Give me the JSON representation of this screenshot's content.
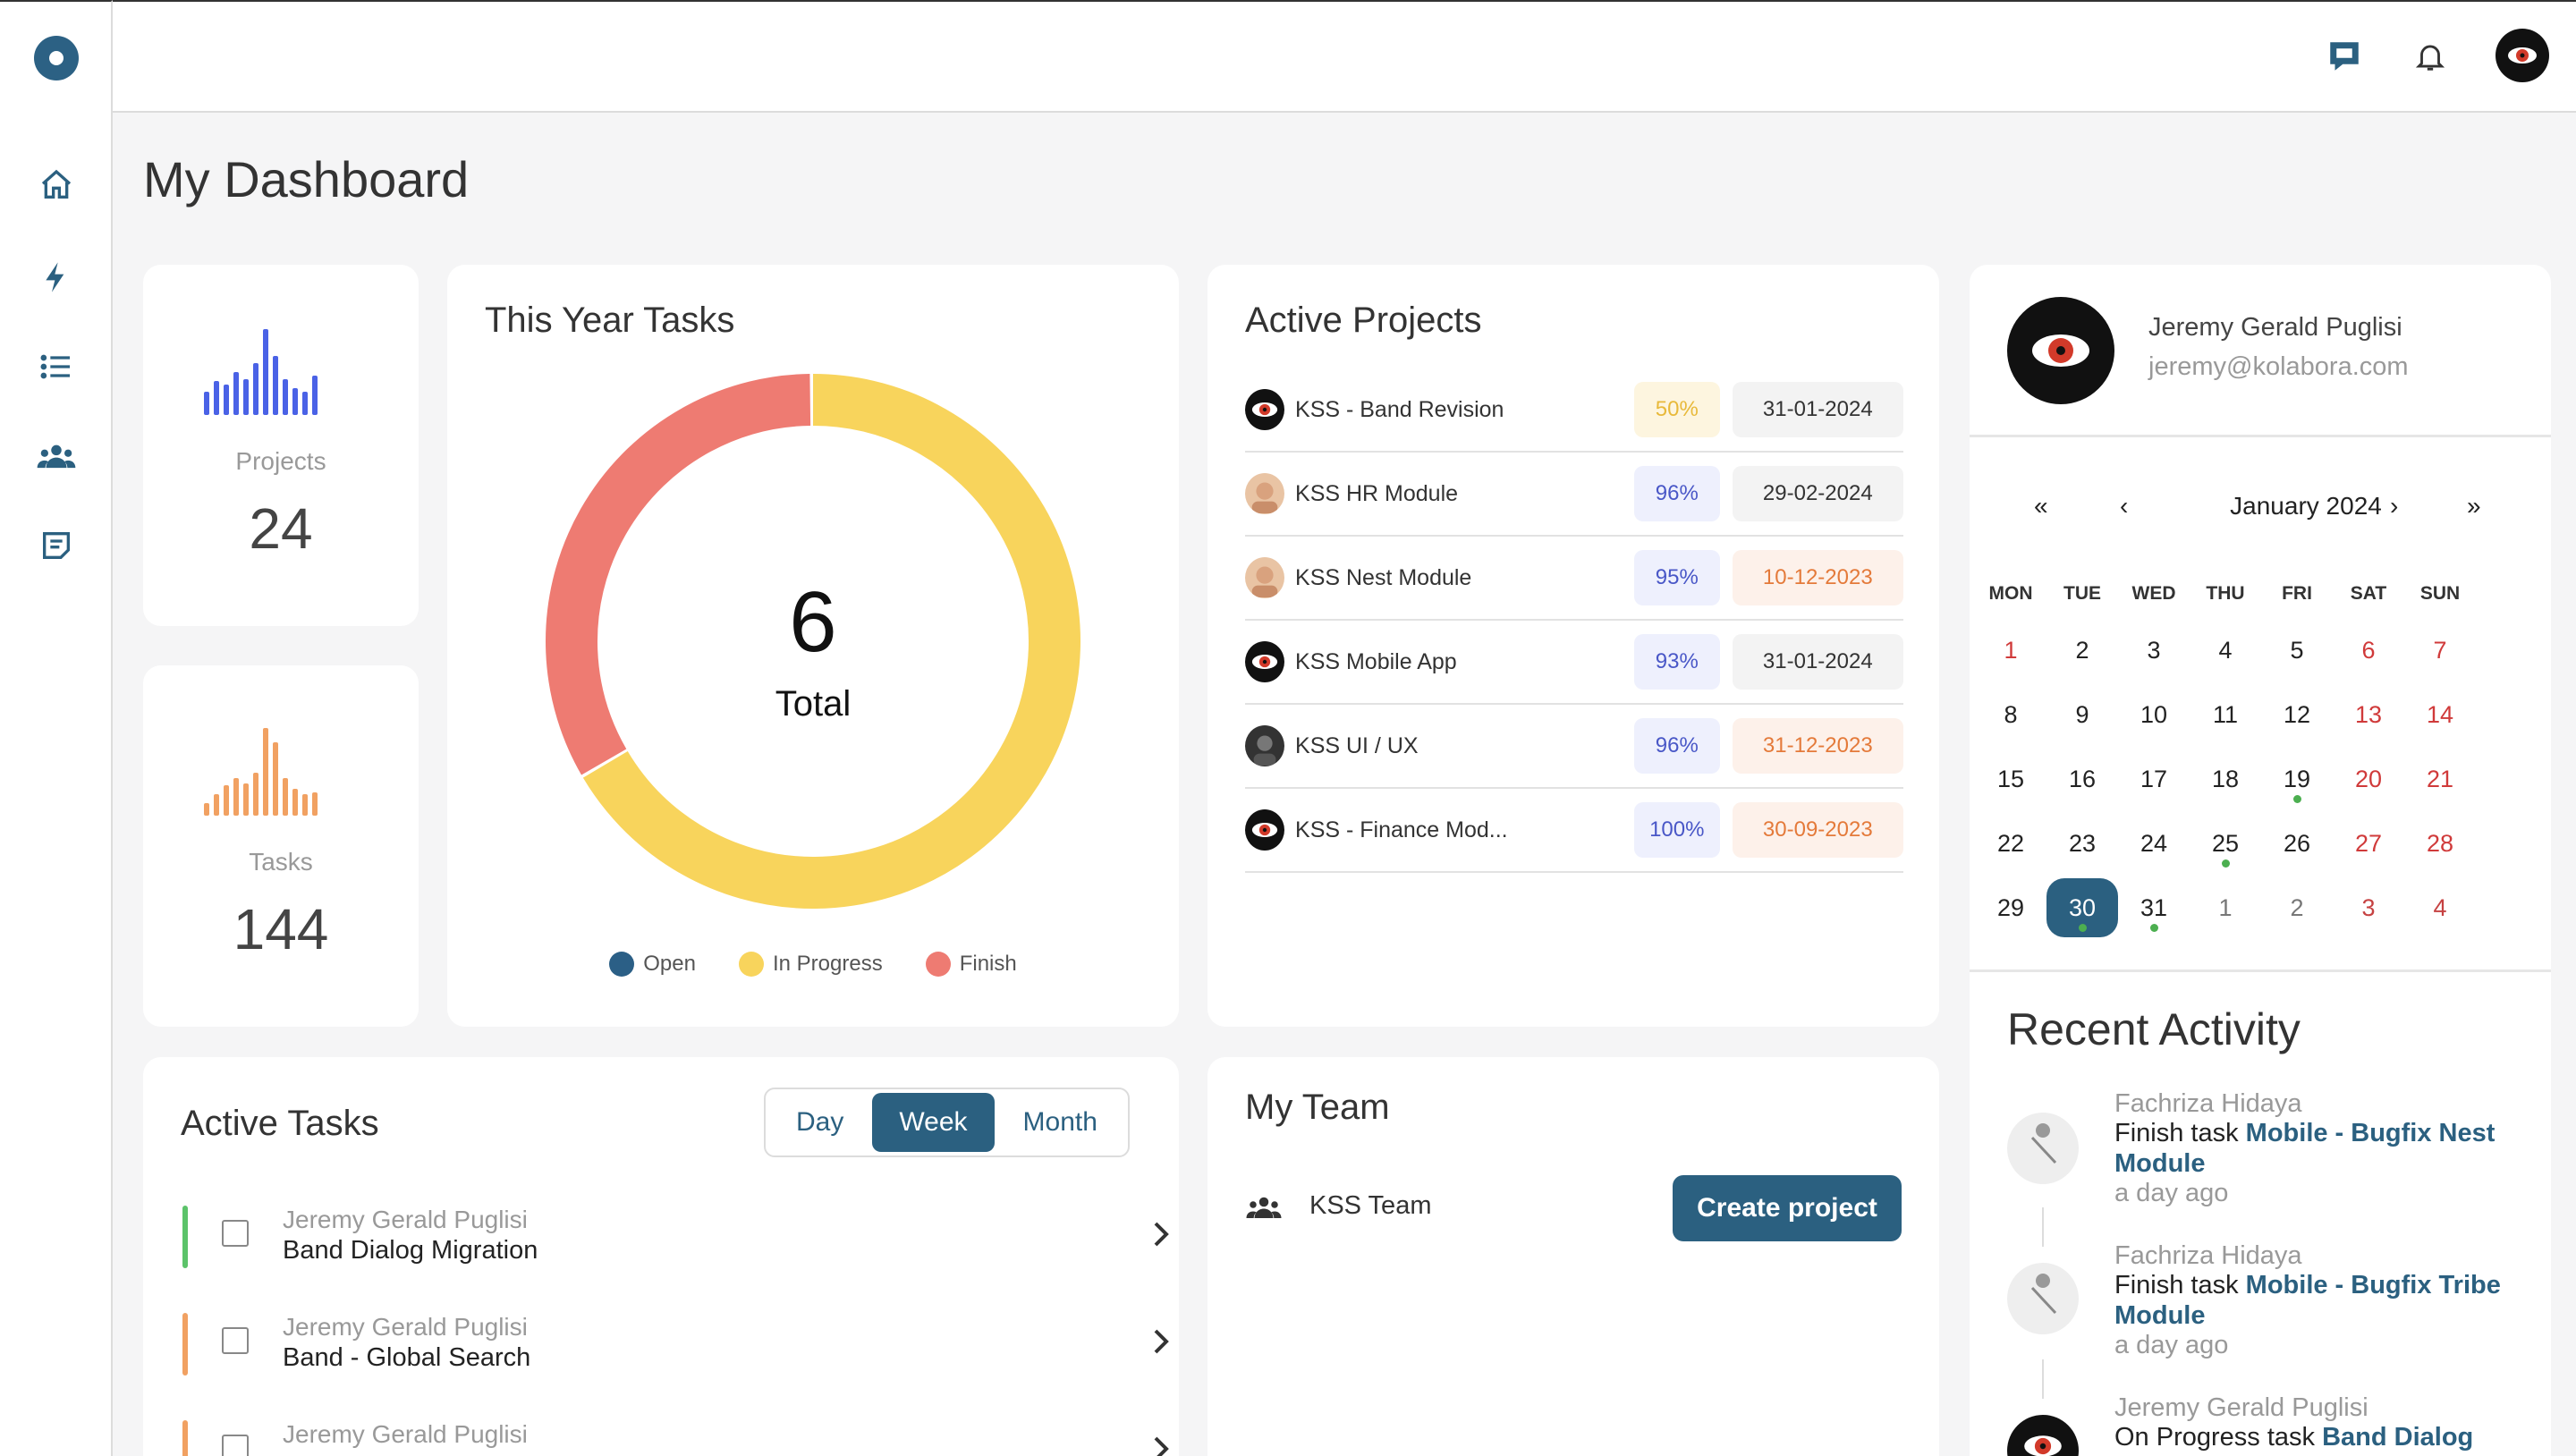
{
  "app": {
    "page_title": "My Dashboard"
  },
  "sidebar": {
    "items": [
      {
        "name": "home-icon"
      },
      {
        "name": "lightning-icon"
      },
      {
        "name": "list-icon"
      },
      {
        "name": "team-icon"
      },
      {
        "name": "notes-icon"
      }
    ]
  },
  "stats": {
    "projects": {
      "label": "Projects",
      "value": "24"
    },
    "tasks": {
      "label": "Tasks",
      "value": "144"
    }
  },
  "year_tasks": {
    "title": "This Year Tasks",
    "total_value": "6",
    "total_label": "Total",
    "legend": [
      {
        "label": "Open",
        "color": "#2b5f86"
      },
      {
        "label": "In Progress",
        "color": "#f8d45c"
      },
      {
        "label": "Finish",
        "color": "#ee7b72"
      }
    ]
  },
  "chart_data": {
    "type": "pie",
    "categories": [
      "Open",
      "In Progress",
      "Finish"
    ],
    "values": [
      0,
      4,
      2
    ],
    "colors": [
      "#2b5f86",
      "#f8d45c",
      "#ee7b72"
    ],
    "title": "This Year Tasks"
  },
  "active_projects": {
    "title": "Active Projects",
    "rows": [
      {
        "name": "KSS - Band Revision",
        "pct": "50%",
        "pct_style": "yellow",
        "date": "31-01-2024",
        "date_style": "gray",
        "avatar": "eye"
      },
      {
        "name": "KSS HR Module",
        "pct": "96%",
        "pct_style": "blue",
        "date": "29-02-2024",
        "date_style": "gray",
        "avatar": "face"
      },
      {
        "name": "KSS Nest Module",
        "pct": "95%",
        "pct_style": "blue",
        "date": "10-12-2023",
        "date_style": "orange",
        "avatar": "face"
      },
      {
        "name": "KSS Mobile App",
        "pct": "93%",
        "pct_style": "blue",
        "date": "31-01-2024",
        "date_style": "gray",
        "avatar": "eye"
      },
      {
        "name": "KSS UI / UX",
        "pct": "96%",
        "pct_style": "blue",
        "date": "31-12-2023",
        "date_style": "orange",
        "avatar": "dark"
      },
      {
        "name": "KSS - Finance Mod...",
        "pct": "100%",
        "pct_style": "blue",
        "date": "30-09-2023",
        "date_style": "orange",
        "avatar": "eye"
      }
    ]
  },
  "profile": {
    "name": "Jeremy Gerald Puglisi",
    "email": "jeremy@kolabora.com"
  },
  "calendar": {
    "month_label": "January 2024",
    "nav": {
      "first": "«",
      "prev": "‹",
      "next": "›",
      "last": "»"
    },
    "dow": [
      "MON",
      "TUE",
      "WED",
      "THU",
      "FRI",
      "SAT",
      "SUN"
    ],
    "weeks": [
      [
        "1",
        "2",
        "3",
        "4",
        "5",
        "6",
        "7"
      ],
      [
        "8",
        "9",
        "10",
        "11",
        "12",
        "13",
        "14"
      ],
      [
        "15",
        "16",
        "17",
        "18",
        "19",
        "20",
        "21"
      ],
      [
        "22",
        "23",
        "24",
        "25",
        "26",
        "27",
        "28"
      ],
      [
        "29",
        "30",
        "31",
        "1",
        "2",
        "3",
        "4"
      ]
    ],
    "selected_day": "30"
  },
  "active_tasks": {
    "title": "Active Tasks",
    "ranges": [
      "Day",
      "Week",
      "Month"
    ],
    "active_range": "Week",
    "rows": [
      {
        "user": "Jeremy Gerald Puglisi",
        "title": "Band Dialog Migration",
        "color": "#5cc36a"
      },
      {
        "user": "Jeremy Gerald Puglisi",
        "title": "Band - Global Search",
        "color": "#f1a162"
      },
      {
        "user": "Jeremy Gerald Puglisi",
        "title": "",
        "color": "#f1a162"
      }
    ]
  },
  "team": {
    "title": "My Team",
    "team_name": "KSS Team",
    "create_label": "Create project"
  },
  "recent_activity": {
    "title": "Recent Activity",
    "items": [
      {
        "user": "Fachriza Hidaya",
        "action": "Finish task ",
        "link": "Mobile - Bugfix Nest Module",
        "time": "a day ago"
      },
      {
        "user": "Fachriza Hidaya",
        "action": "Finish task ",
        "link": "Mobile - Bugfix Tribe Module",
        "time": "a day ago"
      },
      {
        "user": "Jeremy Gerald Puglisi",
        "action": "On Progress task ",
        "link": "Band Dialog",
        "time": ""
      }
    ]
  }
}
